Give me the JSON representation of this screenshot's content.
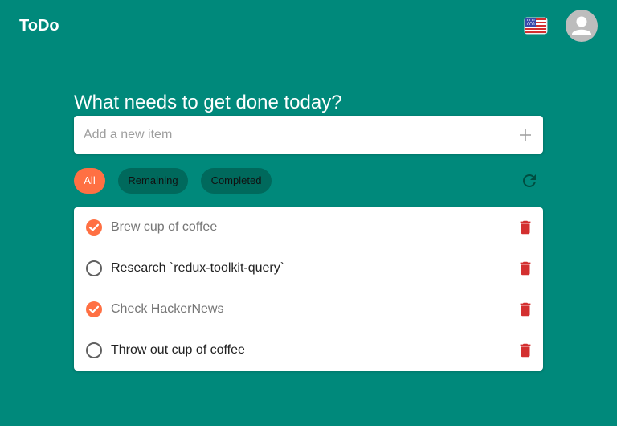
{
  "app": {
    "title": "ToDo"
  },
  "header": {
    "language_icon": "us-flag-icon",
    "account_icon": "account-circle-icon"
  },
  "main": {
    "heading": "What needs to get done today?",
    "add_input": {
      "placeholder": "Add a new item",
      "value": "",
      "button_icon": "plus-icon"
    },
    "filters": [
      {
        "label": "All",
        "active": true
      },
      {
        "label": "Remaining",
        "active": false
      },
      {
        "label": "Completed",
        "active": false
      }
    ],
    "refresh_icon": "refresh-icon",
    "items": [
      {
        "text": "Brew cup of coffee",
        "completed": true
      },
      {
        "text": "Research `redux-toolkit-query`",
        "completed": false
      },
      {
        "text": "Check HackerNews",
        "completed": true
      },
      {
        "text": "Throw out cup of coffee",
        "completed": false
      }
    ]
  },
  "colors": {
    "background": "#00897b",
    "accent": "#ff7043",
    "chip_inactive": "#00695c",
    "delete": "#d32f2f",
    "unchecked": "#616161"
  }
}
